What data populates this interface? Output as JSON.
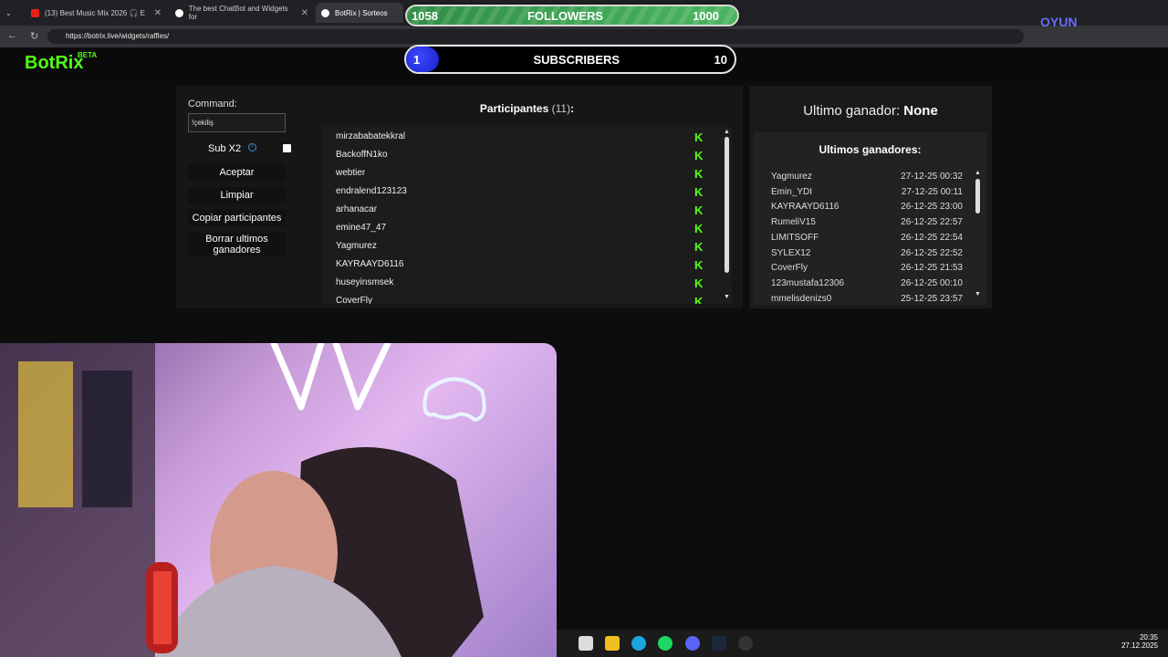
{
  "browser": {
    "tabs": [
      {
        "label": "(13) Best Music Mix 2026 🎧 E"
      },
      {
        "label": "The best ChatBot and Widgets for"
      },
      {
        "label": "BotRix | Sorteos"
      }
    ],
    "url": "https://botrix.live/widgets/raffles/"
  },
  "overlay": {
    "followers_current": "1058",
    "followers_label": "FOLLOWERS",
    "followers_goal": "1000",
    "subs_current": "1",
    "subs_label": "SUBSCRIBERS",
    "subs_goal": "10",
    "subs_progress": 0.1
  },
  "site": {
    "logo": "BotRix",
    "beta": "BETA"
  },
  "raffle": {
    "command_label": "Command:",
    "command_value": "!çekiliş",
    "sub_x2_label": "Sub X2",
    "buttons": {
      "accept": "Aceptar",
      "clear": "Limpiar",
      "copy": "Copiar participantes",
      "delete_last": "Borrar ultimos ganadores"
    },
    "participants_title": "Participantes",
    "participants_count": "(11)",
    "participants": [
      "mirzababatekkral",
      "BackoffN1ko",
      "webtier",
      "endralend123123",
      "arhanacar",
      "emine47_47",
      "Yagmurez",
      "KAYRAAYD6116",
      "huseyinsmsek",
      "CoverFly"
    ]
  },
  "winners": {
    "last_winner_label": "Ultimo ganador:",
    "last_winner_value": "None",
    "list_title": "Ultimos ganadores:",
    "rows": [
      {
        "name": "Yagmurez",
        "time": "27-12-25 00:32"
      },
      {
        "name": "Emin_YDI",
        "time": "27-12-25 00:11"
      },
      {
        "name": "KAYRAAYD6116",
        "time": "26-12-25 23:00"
      },
      {
        "name": "RumeliV15",
        "time": "26-12-25 22:57"
      },
      {
        "name": "LIMITSOFF",
        "time": "26-12-25 22:54"
      },
      {
        "name": "SYLEX12",
        "time": "26-12-25 22:52"
      },
      {
        "name": "CoverFly",
        "time": "26-12-25 21:53"
      },
      {
        "name": "123mustafa12306",
        "time": "26-12-25 00:10"
      },
      {
        "name": "mmelisdenizs0",
        "time": "25-12-25 23:57"
      }
    ]
  },
  "taskbar": {
    "time": "20:35",
    "date": "27.12.2025"
  },
  "watermark": "OYUN"
}
